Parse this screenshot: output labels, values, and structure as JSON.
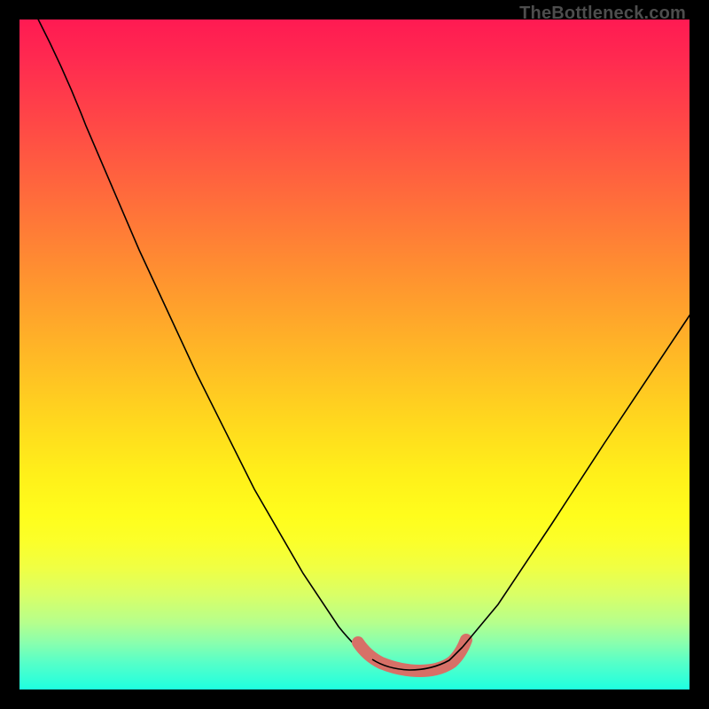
{
  "watermark": "TheBottleneck.com",
  "colors": {
    "frame": "#000000",
    "curve": "#000000",
    "highlight": "#d77067",
    "gradient_top": "#ff1a52",
    "gradient_mid": "#fff01a",
    "gradient_bottom": "#1effe0"
  },
  "chart_data": {
    "type": "line",
    "title": "",
    "xlabel": "",
    "ylabel": "",
    "x_range": [
      0,
      100
    ],
    "y_range": [
      0,
      100
    ],
    "series": [
      {
        "name": "bottleneck-curve",
        "x": [
          0,
          5,
          9,
          14,
          20,
          26,
          32,
          38,
          44,
          48,
          50,
          52,
          55,
          58,
          61,
          64,
          68,
          74,
          80,
          86,
          92,
          100
        ],
        "values": [
          100,
          94,
          85,
          75,
          63,
          51,
          39,
          27,
          15,
          7,
          4,
          2,
          1,
          1,
          2,
          5,
          10,
          19,
          29,
          39,
          48,
          60
        ]
      }
    ],
    "highlight_region": {
      "description": "trough plateau of the curve marked with thick coral stroke",
      "x": [
        48,
        50,
        52,
        55,
        58,
        61,
        64
      ],
      "values": [
        7,
        4,
        2,
        1,
        1,
        2,
        5
      ]
    },
    "notes": "Background is a vertical heat gradient from red (top, high bottleneck) to green (bottom, low bottleneck). The single black curve is V-shaped with its minimum near x≈56. The trough is emphasized with a thick coral brush stroke. No axis ticks or numeric labels are visible; values are estimated on a 0–100 normalized scale."
  }
}
